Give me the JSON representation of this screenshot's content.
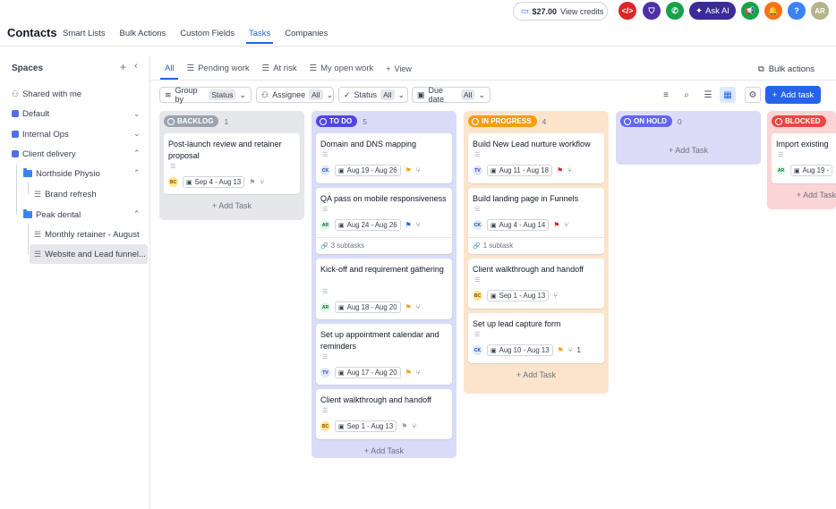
{
  "app": {
    "title": "Contacts",
    "nav_tabs": [
      "Smart Lists",
      "Bulk Actions",
      "Custom Fields",
      "Tasks",
      "Companies"
    ],
    "credits_amount": "$27.00",
    "credits_label": "View credits",
    "ask_ai_label": "Ask AI",
    "avatar_initials": "AR",
    "help_label": "?"
  },
  "sidebar": {
    "title": "Spaces",
    "shared": "Shared with me",
    "items": [
      "Default",
      "Internal Ops",
      "Client delivery"
    ],
    "folders": [
      "Northside Physio",
      "Peak dental"
    ],
    "lists": [
      "Brand refresh",
      "Monthly retainer - August",
      "Website and Lead funnel..."
    ]
  },
  "view_tabs": {
    "all": "All",
    "pending": "Pending work",
    "at_risk": "At risk",
    "my_open": "My open work",
    "view": "View",
    "bulk_actions": "Bulk actions"
  },
  "filters": {
    "group_by": "Group by",
    "group_by_value": "Status",
    "assignee": "Assignee",
    "assignee_value": "All",
    "status": "Status",
    "status_value": "All",
    "due_date": "Due date",
    "due_date_value": "All",
    "add_task": "Add task"
  },
  "add_task_label": "+ Add Task",
  "columns": [
    {
      "name": "BACKLOG",
      "count": "1",
      "color": "#9ca3af",
      "cards": [
        {
          "title": "Post-launch review and retainer proposal",
          "avatar": "BC",
          "date": "Sep 4 - Aug 13",
          "flag": "gray"
        }
      ]
    },
    {
      "name": "TO DO",
      "count": "5",
      "color": "#4f46e5",
      "cards": [
        {
          "title": "Domain and DNS mapping",
          "avatar": "CK",
          "date": "Aug 19 - Aug 26",
          "flag": "orange"
        },
        {
          "title": "QA pass on mobile responsiveness",
          "avatar": "AR",
          "date": "Aug 24 - Aug 26",
          "flag": "blue",
          "subtasks": "3 subtasks"
        },
        {
          "title": "Kick-off and requirement gathering",
          "avatar": "AR",
          "date": "Aug 18 - Aug 20",
          "flag": "orange"
        },
        {
          "title": "Set up appointment calendar and reminders",
          "avatar": "TV",
          "date": "Aug 17 - Aug 20",
          "flag": "orange"
        },
        {
          "title": "Client walkthrough and handoff",
          "avatar": "BC",
          "date": "Sep 1 - Aug 13",
          "flag": "gray"
        }
      ]
    },
    {
      "name": "IN PROGRESS",
      "count": "4",
      "color": "#f59e0b",
      "cards": [
        {
          "title": "Build New Lead nurture workflow",
          "avatar": "TV",
          "date": "Aug 11 - Aug 18",
          "flag": "red"
        },
        {
          "title": "Build landing page in Funnels",
          "avatar": "CK",
          "date": "Aug 4 - Aug 14",
          "flag": "red",
          "subtasks": "1 subtask"
        },
        {
          "title": "Client walkthrough and handoff",
          "avatar": "BC",
          "date": "Sep 1 - Aug 13",
          "flag": "none"
        },
        {
          "title": "Set up lead capture form",
          "avatar": "CK",
          "date": "Aug 10 - Aug 13",
          "flag": "orange",
          "deps": "1"
        }
      ]
    },
    {
      "name": "ON HOLD",
      "count": "0",
      "color": "#6366f1",
      "cards": []
    },
    {
      "name": "BLOCKED",
      "count": "",
      "color": "#ef4444",
      "cards": [
        {
          "title": "Import existing",
          "avatar": "AR",
          "date": "Aug 19 -",
          "flag": "none"
        }
      ]
    }
  ],
  "colors": {
    "accent": "#2563eb",
    "backlog_bg": "#e5e7eb",
    "todo_bg": "#d9dcf7",
    "inprogress_bg": "#fbe4cc",
    "onhold_bg": "#dcdcf7",
    "blocked_bg": "#fbd5d5"
  }
}
